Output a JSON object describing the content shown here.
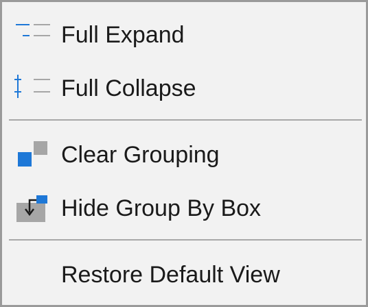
{
  "menu": {
    "items": [
      {
        "label": "Full Expand",
        "icon": "full-expand-icon"
      },
      {
        "label": "Full Collapse",
        "icon": "full-collapse-icon"
      },
      {
        "label": "Clear Grouping",
        "icon": "clear-grouping-icon"
      },
      {
        "label": "Hide Group By Box",
        "icon": "hide-group-by-box-icon"
      },
      {
        "label": "Restore Default View",
        "icon": ""
      }
    ]
  },
  "colors": {
    "menu_background": "#f2f2f2",
    "menu_border": "#9a9a9a",
    "separator": "#a8a8a8",
    "icon_blue": "#1e78d7",
    "icon_gray": "#a6a6a6",
    "text": "#1a1a1a"
  }
}
